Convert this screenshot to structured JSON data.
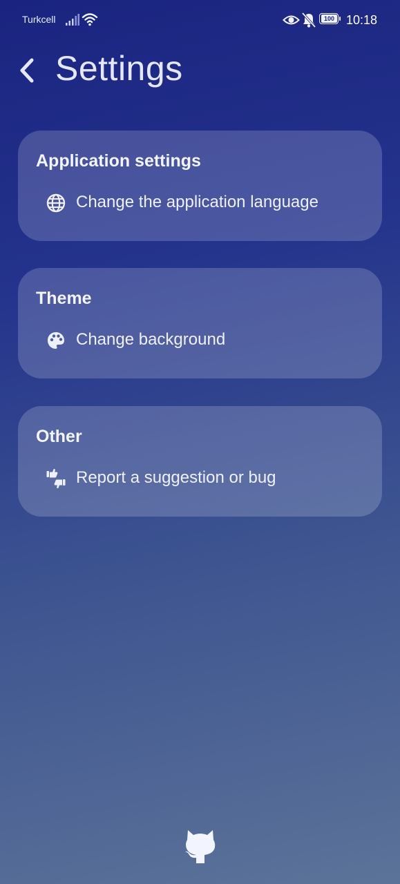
{
  "status_bar": {
    "carrier": "Turkcell",
    "battery": "100",
    "time": "10:18"
  },
  "header": {
    "title": "Settings"
  },
  "sections": [
    {
      "title": "Application settings",
      "item": {
        "label": "Change the application language",
        "icon": "globe-icon"
      }
    },
    {
      "title": "Theme",
      "item": {
        "label": "Change background",
        "icon": "palette-icon"
      }
    },
    {
      "title": "Other",
      "item": {
        "label": "Report a suggestion or bug",
        "icon": "thumbs-up-down-icon"
      }
    }
  ],
  "footer": {
    "icon": "github-icon"
  },
  "colors": {
    "gradient_top": "#1a2480",
    "gradient_bottom": "#5c7399",
    "card": "rgba(255,255,255,0.18)"
  }
}
